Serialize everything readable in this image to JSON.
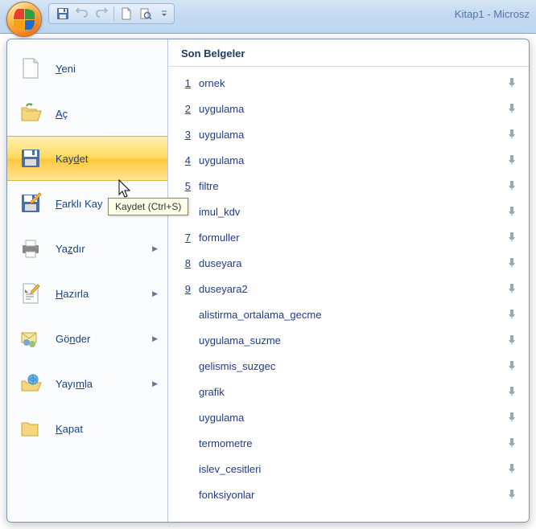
{
  "title": "Kitap1 - Microsz",
  "tooltip": "Kaydet (Ctrl+S)",
  "qat": {
    "save": "save-icon",
    "undo": "undo-icon",
    "redo": "redo-icon",
    "new": "new-icon",
    "preview": "preview-icon"
  },
  "menu": {
    "new": "Yeni",
    "open": "Aç",
    "save": "Kaydet",
    "saveas": "Farklı Kay",
    "print": "Yazdır",
    "prepare": "Hazırla",
    "send": "Gönder",
    "publish": "Yayımla",
    "close": "Kapat"
  },
  "recent": {
    "header": "Son Belgeler",
    "items": [
      {
        "num": "1",
        "name": "ornek"
      },
      {
        "num": "2",
        "name": "uygulama"
      },
      {
        "num": "3",
        "name": "uygulama"
      },
      {
        "num": "4",
        "name": "uygulama"
      },
      {
        "num": "5",
        "name": "filtre"
      },
      {
        "num": "",
        "name": "imul_kdv"
      },
      {
        "num": "7",
        "name": "formuller"
      },
      {
        "num": "8",
        "name": "duseyara"
      },
      {
        "num": "9",
        "name": "duseyara2"
      },
      {
        "num": "",
        "name": "alistirma_ortalama_gecme"
      },
      {
        "num": "",
        "name": "uygulama_suzme"
      },
      {
        "num": "",
        "name": "gelismis_suzgec"
      },
      {
        "num": "",
        "name": "grafik"
      },
      {
        "num": "",
        "name": "uygulama"
      },
      {
        "num": "",
        "name": "termometre"
      },
      {
        "num": "",
        "name": "islev_cesitleri"
      },
      {
        "num": "",
        "name": "fonksiyonlar"
      }
    ]
  }
}
